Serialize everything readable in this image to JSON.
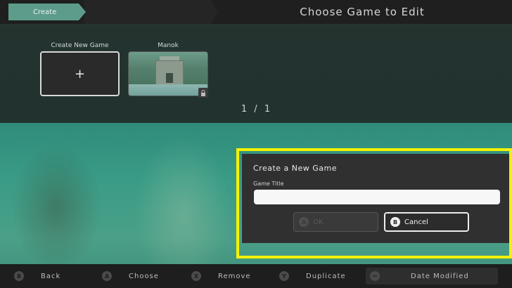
{
  "header": {
    "tab_label": "Create",
    "title": "Choose Game to Edit"
  },
  "games": {
    "create_label": "Create New Game",
    "create_symbol": "+",
    "items": [
      {
        "label": "Manok"
      }
    ],
    "pager": "1 / 1"
  },
  "dialog": {
    "title": "Create a New Game",
    "field_label": "Game Title",
    "input_value": "",
    "ok_badge": "A",
    "ok_label": "OK",
    "cancel_badge": "B",
    "cancel_label": "Cancel"
  },
  "bottom_bar": {
    "hints": [
      {
        "badge": "B",
        "label": "Back"
      },
      {
        "badge": "A",
        "label": "Choose"
      },
      {
        "badge": "X",
        "label": "Remove"
      },
      {
        "badge": "Y",
        "label": "Duplicate"
      }
    ],
    "sort_badge": "−",
    "sort_label": "Date Modified"
  },
  "colors": {
    "accent": "#5d9c8b",
    "highlight": "#f5f200",
    "dialog_bg": "#303030"
  },
  "icons": {
    "lock": "lock-icon",
    "plus": "plus-icon"
  }
}
